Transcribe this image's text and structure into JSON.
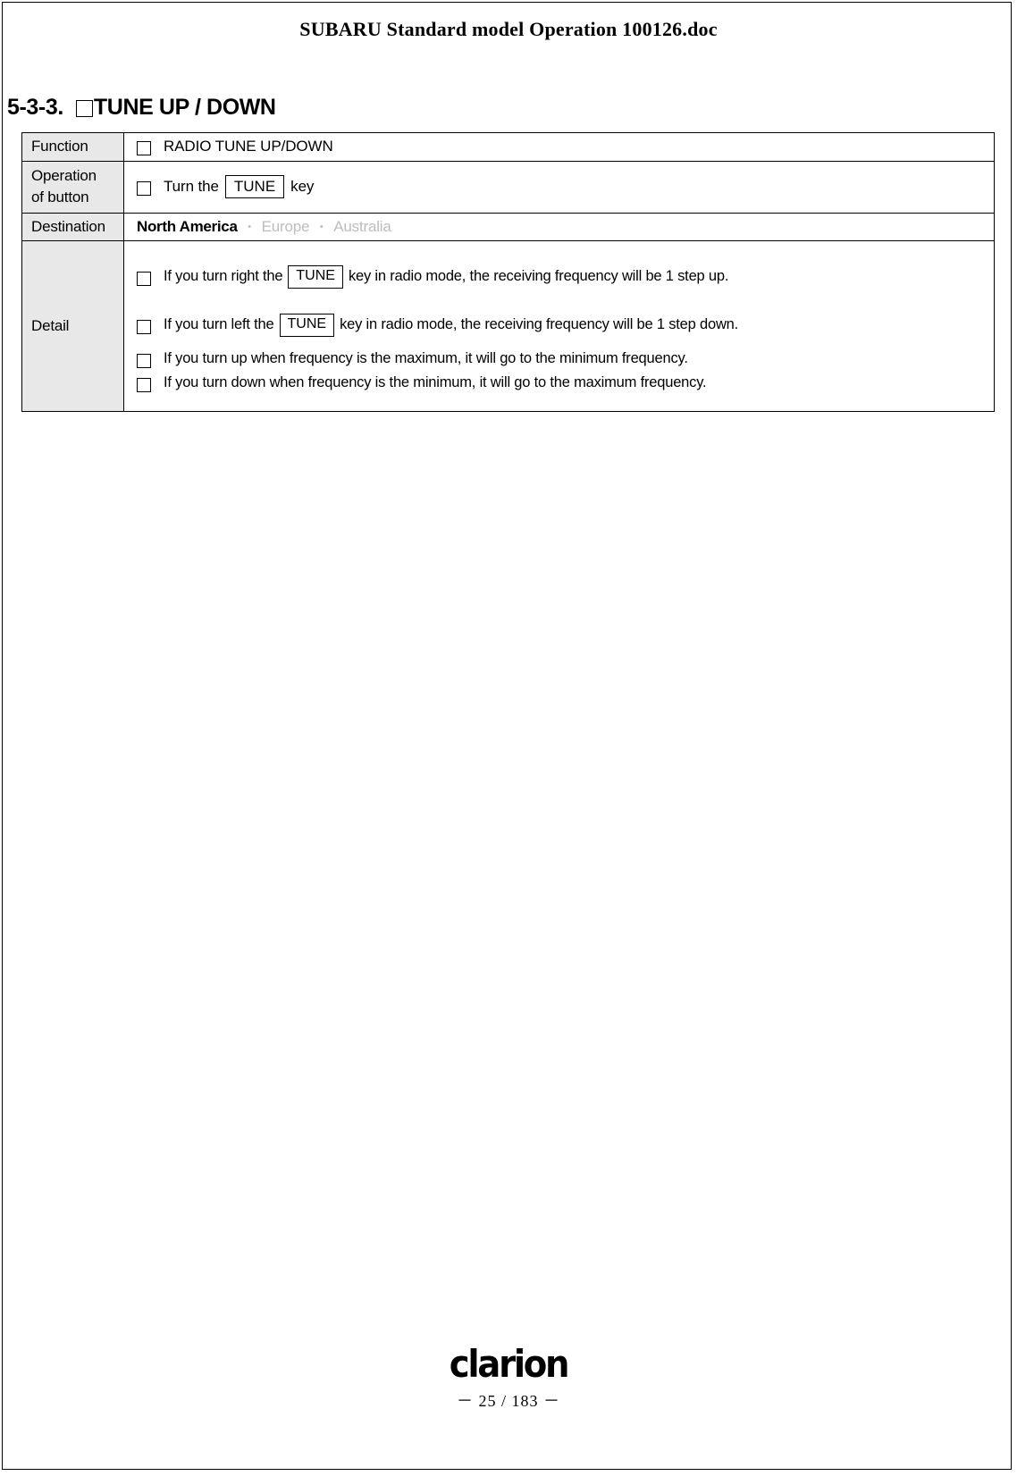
{
  "document": {
    "header_title": "SUBARU Standard model Operation 100126.doc"
  },
  "section": {
    "number": "5-3-3.",
    "title": "TUNE UP / DOWN",
    "checkbox_glyph": "empty-checkbox"
  },
  "table": {
    "labels": {
      "function": "Function",
      "operation": "Operation of button",
      "operation_line1": "Operation",
      "operation_line2": "of button",
      "destination": "Destination",
      "detail": "Detail"
    },
    "function": {
      "text": "RADIO  TUNE UP/DOWN"
    },
    "operation": {
      "prefix": "Turn the",
      "key": "TUNE",
      "suffix": "key"
    },
    "destination": {
      "options": [
        {
          "label": "North America",
          "selected": true
        },
        {
          "label": "Europe",
          "selected": false
        },
        {
          "label": "Australia",
          "selected": false
        }
      ],
      "separator": "・"
    },
    "detail": {
      "items": [
        {
          "prefix": "If you turn right the",
          "key": "TUNE",
          "suffix": "key in radio mode, the receiving frequency will be 1 step up."
        },
        {
          "prefix": "If you turn left the",
          "key": "TUNE",
          "suffix": "key in radio mode, the receiving frequency will be 1 step down."
        },
        {
          "prefix": "If you turn up when frequency is the maximum, it will go to the minimum frequency.",
          "key": "",
          "suffix": ""
        },
        {
          "prefix": "If you turn down when frequency is the minimum, it will go to the maximum frequency.",
          "key": "",
          "suffix": ""
        }
      ]
    }
  },
  "footer": {
    "brand": "clarion",
    "page_number": "－ 25 / 183 －"
  },
  "colors": {
    "label_background": "#e8e8e8",
    "inactive_text": "#bdbdbd",
    "border": "#000000",
    "text": "#000000"
  }
}
